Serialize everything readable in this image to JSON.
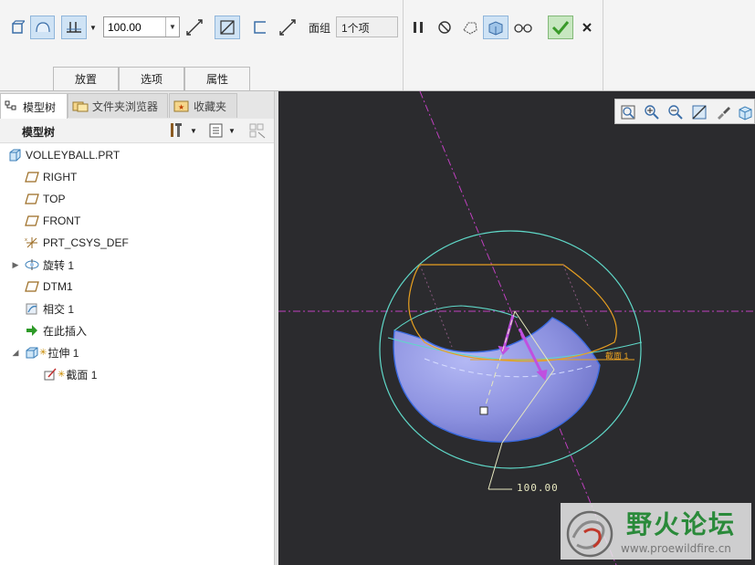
{
  "dashboard": {
    "depth_value": "100.00",
    "surface_group_label": "面组",
    "surface_group_value": "1个项",
    "tabs": [
      "放置",
      "选项",
      "属性"
    ]
  },
  "navigator": {
    "tabs": [
      "模型树",
      "文件夹浏览器",
      "收藏夹"
    ],
    "header_label": "模型树",
    "tree": [
      {
        "label": "VOLLEYBALL.PRT",
        "icon": "part-icon"
      },
      {
        "label": "RIGHT",
        "icon": "datum-plane-icon"
      },
      {
        "label": "TOP",
        "icon": "datum-plane-icon"
      },
      {
        "label": "FRONT",
        "icon": "datum-plane-icon"
      },
      {
        "label": "PRT_CSYS_DEF",
        "icon": "csys-icon"
      },
      {
        "label": "旋转 1",
        "icon": "revolve-icon"
      },
      {
        "label": "DTM1",
        "icon": "datum-plane-icon"
      },
      {
        "label": "相交 1",
        "icon": "intersect-icon"
      },
      {
        "label": "在此插入",
        "icon": "insert-here-arrow-icon"
      },
      {
        "label": "拉伸 1",
        "icon": "extrude-icon"
      },
      {
        "label": "截面 1",
        "icon": "sketch-icon"
      }
    ]
  },
  "graphics": {
    "dimension_value": "100.00",
    "plane_label": "截面 1"
  },
  "watermark": {
    "title": "野火论坛",
    "url": "www.proewildfire.cn"
  },
  "colors": {
    "accent_blue": "#8fb5da",
    "confirm_green": "#3a9a2a",
    "surface_blue": "#8d92e0",
    "sketch_orange": "#e8a020",
    "datum_magenta": "#c040c0",
    "edge_cyan": "#5fd8c8"
  }
}
